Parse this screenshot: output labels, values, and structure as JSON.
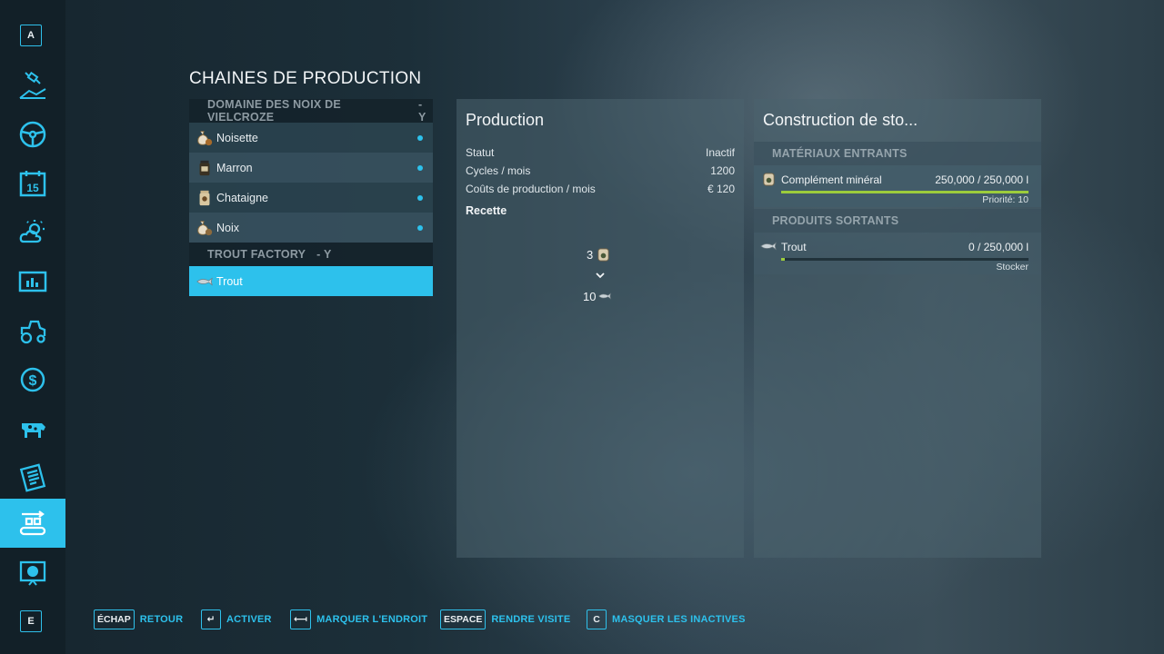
{
  "sidebar": {
    "top_key": "A",
    "bottom_key": "E",
    "items": [
      {
        "icon": "map-satellite-icon"
      },
      {
        "icon": "steering-wheel-icon"
      },
      {
        "icon": "calendar-icon",
        "text": "15"
      },
      {
        "icon": "weather-icon"
      },
      {
        "icon": "statistics-icon"
      },
      {
        "icon": "vehicles-icon"
      },
      {
        "icon": "finances-icon"
      },
      {
        "icon": "animals-icon"
      },
      {
        "icon": "contracts-icon"
      },
      {
        "icon": "production-chains-icon",
        "active": true
      },
      {
        "icon": "help-icon"
      }
    ]
  },
  "page_title": "CHAINES DE PRODUCTION",
  "production_list": {
    "groups": [
      {
        "header": "DOMAINE DES NOIX DE VIELCROZE",
        "suffix": "- Y",
        "items": [
          {
            "label": "Noisette",
            "icon": "hazelnut-icon"
          },
          {
            "label": "Marron",
            "icon": "chestnut-jar-icon"
          },
          {
            "label": "Chataigne",
            "icon": "chestnut-jar-icon"
          },
          {
            "label": "Noix",
            "icon": "walnut-icon"
          }
        ]
      },
      {
        "header": "TROUT FACTORY",
        "suffix": "- Y",
        "items": [
          {
            "label": "Trout",
            "icon": "fish-icon",
            "selected": true
          }
        ]
      }
    ]
  },
  "production_panel": {
    "title": "Production",
    "rows": [
      {
        "label": "Statut",
        "value": "Inactif"
      },
      {
        "label": "Cycles / mois",
        "value": "1200"
      },
      {
        "label": "Coûts de production / mois",
        "value": "€ 120"
      }
    ],
    "recipe_title": "Recette",
    "recipe_input_qty": "3",
    "recipe_output_qty": "10"
  },
  "construction_panel": {
    "title": "Construction de sto...",
    "inputs_header": "MATÉRIAUX ENTRANTS",
    "inputs": [
      {
        "name": "Complément minéral",
        "amount": "250,000  / 250,000 l",
        "fill": 1.0,
        "note": "Priorité: 10"
      }
    ],
    "outputs_header": "PRODUITS SORTANTS",
    "outputs": [
      {
        "name": "Trout",
        "amount": "0  / 250,000 l",
        "fill": 0.0,
        "note": "Stocker"
      }
    ]
  },
  "footer": [
    {
      "key": "ÉCHAP",
      "label": "RETOUR"
    },
    {
      "key": "↵",
      "label": "ACTIVER"
    },
    {
      "key": "⟻",
      "label": "MARQUER L'ENDROIT"
    },
    {
      "key": "ESPACE",
      "label": "RENDRE VISITE"
    },
    {
      "key": "C",
      "label": "MASQUER LES INACTIVES"
    }
  ],
  "colors": {
    "accent": "#2dc1ec",
    "bar_fill": "#9ccc3c"
  }
}
